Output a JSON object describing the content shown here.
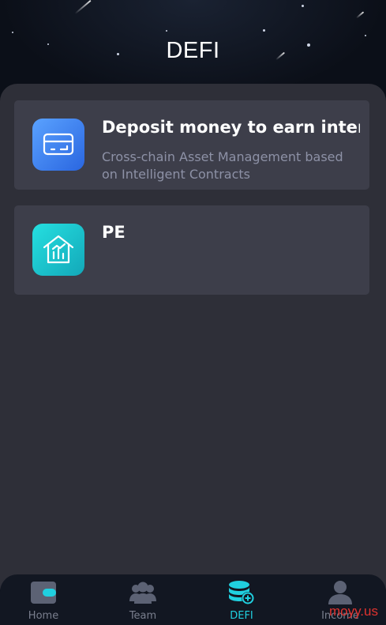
{
  "header": {
    "title": "DEFI"
  },
  "cards": [
    {
      "title": "Deposit money to earn interes",
      "description": "Cross-chain Asset Management based on Intelligent Contracts",
      "icon": "card-wallet-icon",
      "icon_color": "#3d86f5"
    },
    {
      "title": "PE",
      "description": "",
      "icon": "house-chart-icon",
      "icon_color": "#1fc6d2"
    }
  ],
  "tabbar": {
    "active": "DEFI",
    "accent": "#20d0e0",
    "items": [
      {
        "label": "Home",
        "icon": "wallet-icon"
      },
      {
        "label": "Team",
        "icon": "team-icon"
      },
      {
        "label": "DEFI",
        "icon": "coins-icon"
      },
      {
        "label": "Income",
        "icon": "user-icon"
      }
    ]
  },
  "watermark": "moyy.us"
}
